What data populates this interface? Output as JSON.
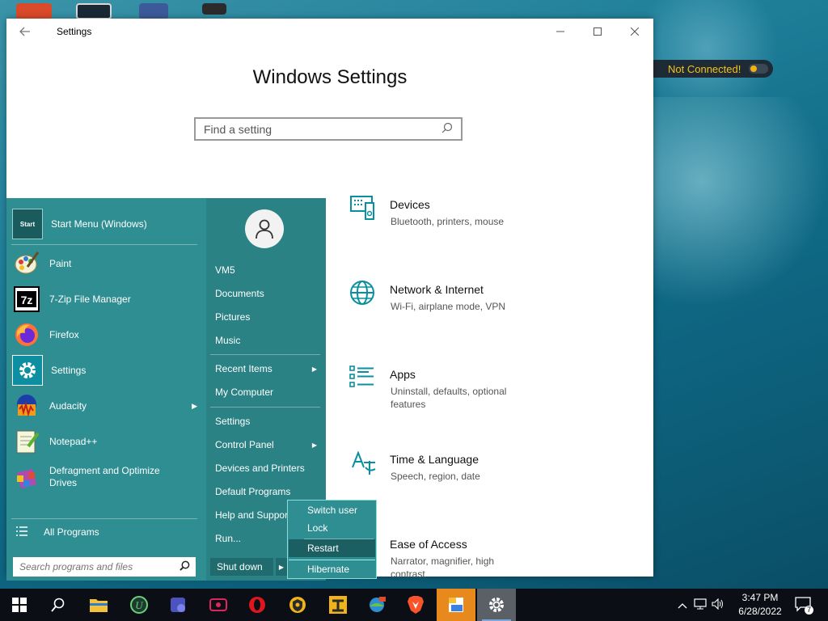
{
  "desktop": {
    "vpn_status": "Not Connected!"
  },
  "settings": {
    "title": "Settings",
    "heading": "Windows Settings",
    "search_placeholder": "Find a setting",
    "categories": [
      {
        "name": "Devices",
        "desc": "Bluetooth, printers, mouse",
        "icon": "devices-icon"
      },
      {
        "name": "Network & Internet",
        "desc": "Wi-Fi, airplane mode, VPN",
        "icon": "globe-icon"
      },
      {
        "name": "Apps",
        "desc": "Uninstall, defaults, optional features",
        "icon": "apps-list-icon"
      },
      {
        "name": "Time & Language",
        "desc": "Speech, region, date",
        "icon": "time-language-icon"
      },
      {
        "name": "Ease of Access",
        "desc": "Narrator, magnifier, high contrast",
        "icon": "ease-of-access-icon"
      }
    ]
  },
  "start_menu": {
    "pinned": [
      {
        "label": "Start Menu (Windows)",
        "icon": "start-menu-icon"
      },
      {
        "label": "Paint",
        "icon": "paint-icon"
      },
      {
        "label": "7-Zip File Manager",
        "icon": "7zip-icon"
      },
      {
        "label": "Firefox",
        "icon": "firefox-icon"
      },
      {
        "label": "Settings",
        "icon": "settings-gear-icon"
      },
      {
        "label": "Audacity",
        "icon": "audacity-icon"
      },
      {
        "label": "Notepad++",
        "icon": "notepadpp-icon"
      },
      {
        "label": "Defragment and Optimize Drives",
        "icon": "defrag-icon"
      }
    ],
    "start_icon_text": "Start",
    "all_programs": "All Programs",
    "search_placeholder": "Search programs and files",
    "right": {
      "user": "VM5",
      "documents": "Documents",
      "pictures": "Pictures",
      "music": "Music",
      "recent_items": "Recent Items",
      "my_computer": "My Computer",
      "settings": "Settings",
      "control_panel": "Control Panel",
      "devices_printers": "Devices and Printers",
      "default_programs": "Default Programs",
      "help_support": "Help and Suppor",
      "run": "Run...",
      "shut_down": "Shut down"
    },
    "flyout": {
      "switch_user": "Switch user",
      "lock": "Lock",
      "restart": "Restart",
      "hibernate": "Hibernate"
    }
  },
  "taskbar": {
    "time": "3:47 PM",
    "date": "6/28/2022",
    "notification_count": "7"
  },
  "colors": {
    "accent": "#00a2a8",
    "start_menu_bg": "#2e8e91",
    "vpn_text": "#f2c31a"
  }
}
